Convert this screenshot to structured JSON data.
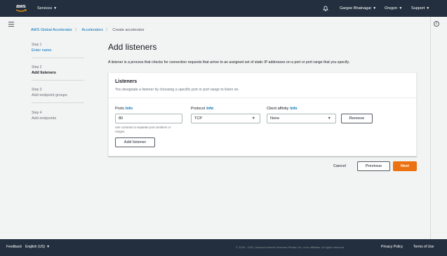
{
  "topnav": {
    "logo": "aws",
    "services": "Services",
    "user": "Gargee Bhatnagar",
    "region": "Oregon",
    "support": "Support",
    "caret": "▼"
  },
  "breadcrumb": {
    "root": "AWS Global Accelerator",
    "section": "Accelerators",
    "current": "Create accelerator",
    "sep": "〉"
  },
  "steps": [
    {
      "num": "Step 1",
      "label": "Enter name"
    },
    {
      "num": "Step 2",
      "label": "Add listeners"
    },
    {
      "num": "Step 3",
      "label": "Add endpoint groups"
    },
    {
      "num": "Step 4",
      "label": "Add endpoints"
    }
  ],
  "page": {
    "title": "Add listeners",
    "description": "A listener is a process that checks for connection requests that arrive to an assigned set of static IP addresses on a port or port range that you specify."
  },
  "panel": {
    "title": "Listeners",
    "subtitle": "You designate a listener by choosing a specific port or port range to listen on.",
    "ports_label": "Ports",
    "protocol_label": "Protocol",
    "affinity_label": "Client affinity",
    "info": "Info",
    "ports_value": "80",
    "protocol_value": "TCP",
    "affinity_value": "None",
    "hint": "Use commas to separate port numbers or ranges.",
    "remove": "Remove",
    "add_listener": "Add listener"
  },
  "actions": {
    "cancel": "Cancel",
    "previous": "Previous",
    "next": "Next"
  },
  "footer": {
    "feedback": "Feedback",
    "language": "English (US)",
    "copyright": "© 2008 - 2020, Amazon Internet Services Private Ltd. or its affiliates. All rights reserved.",
    "privacy": "Privacy Policy",
    "terms": "Terms of Use"
  },
  "colors": {
    "nav": "#232f3e",
    "link": "#0073bb",
    "primary": "#ec7211"
  }
}
